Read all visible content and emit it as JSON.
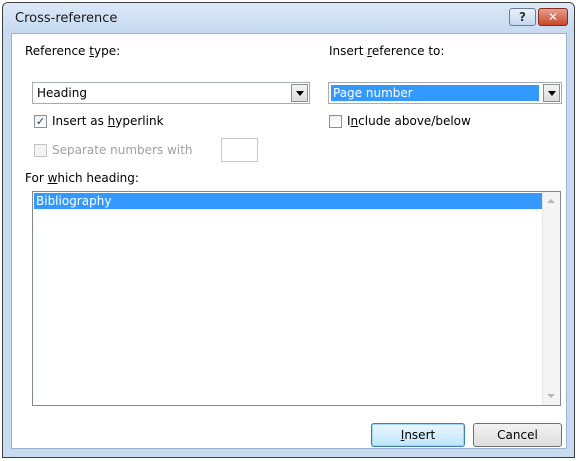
{
  "window": {
    "title": "Cross-reference",
    "help_label": "?",
    "close_label": "✕"
  },
  "reference_type": {
    "label_prefix": "Reference ",
    "label_accel": "t",
    "label_suffix": "ype:",
    "value": "Heading"
  },
  "insert_reference_to": {
    "label_prefix": "Insert ",
    "label_accel": "r",
    "label_suffix": "eference to:",
    "value": "Page number"
  },
  "insert_as_hyperlink": {
    "label_prefix": "Insert as ",
    "label_accel": "h",
    "label_suffix": "yperlink",
    "checked_mark": "✓"
  },
  "include_above_below": {
    "label_prefix": "I",
    "label_accel": "n",
    "label_suffix": "clude above/below"
  },
  "separate_numbers": {
    "label": "Separate numbers with",
    "value": ""
  },
  "for_which_heading": {
    "label_prefix": "For ",
    "label_accel": "w",
    "label_suffix": "hich heading:",
    "items": [
      "Bibliography"
    ]
  },
  "buttons": {
    "insert_accel": "I",
    "insert_rest": "nsert",
    "cancel": "Cancel"
  },
  "colors": {
    "selection": "#3399ff",
    "frame": "#c9dbf1"
  }
}
